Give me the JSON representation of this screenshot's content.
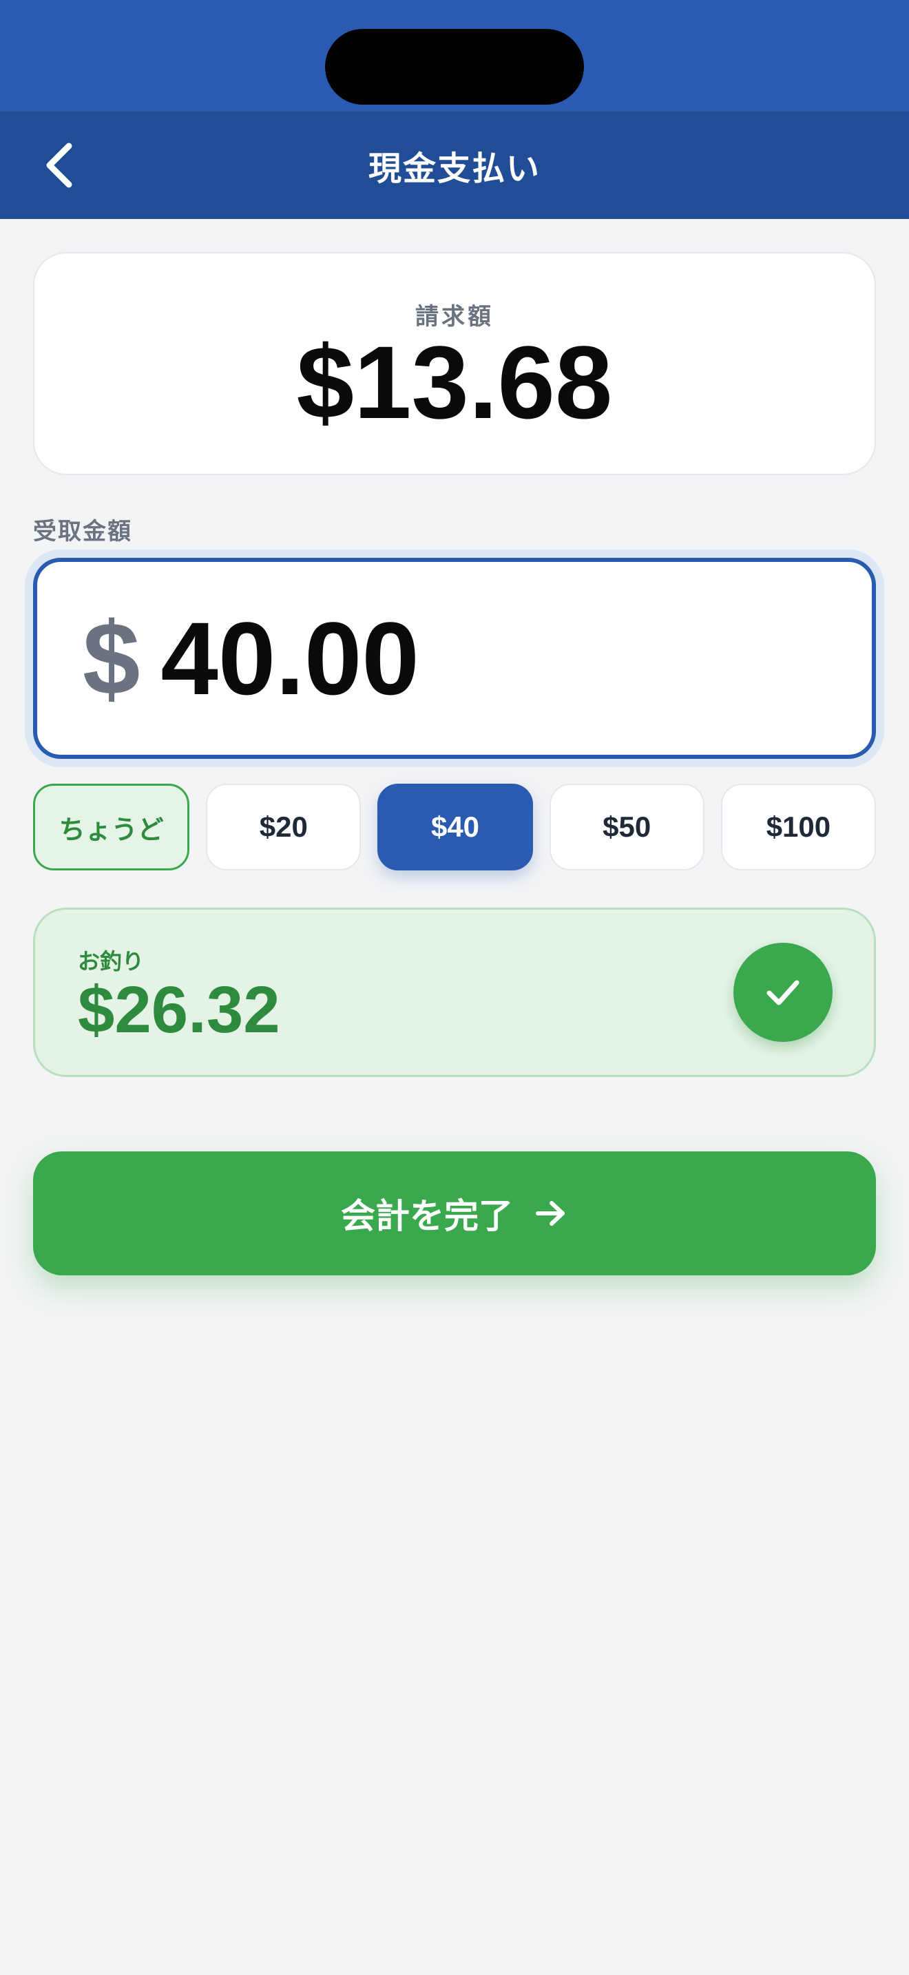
{
  "colors": {
    "primary": "#2b5bb0",
    "primary_dark": "#204d96",
    "success": "#3aa84c",
    "success_text": "#2e8b3e",
    "muted": "#6b7280",
    "background": "#f3f4f6"
  },
  "header": {
    "back_icon": "chevron-left-icon",
    "title": "現金支払い"
  },
  "bill": {
    "label": "請求額",
    "amount": "$13.68"
  },
  "received": {
    "label": "受取金額",
    "currency": "$",
    "value": "40.00"
  },
  "quick_amounts": [
    {
      "label": "ちょうど",
      "state": "exact"
    },
    {
      "label": "$20",
      "state": "default"
    },
    {
      "label": "$40",
      "state": "selected"
    },
    {
      "label": "$50",
      "state": "default"
    },
    {
      "label": "$100",
      "state": "default"
    }
  ],
  "change": {
    "label": "お釣り",
    "amount": "$26.32",
    "icon": "check-icon"
  },
  "complete_button": {
    "label": "会計を完了",
    "icon": "arrow-right-icon"
  }
}
